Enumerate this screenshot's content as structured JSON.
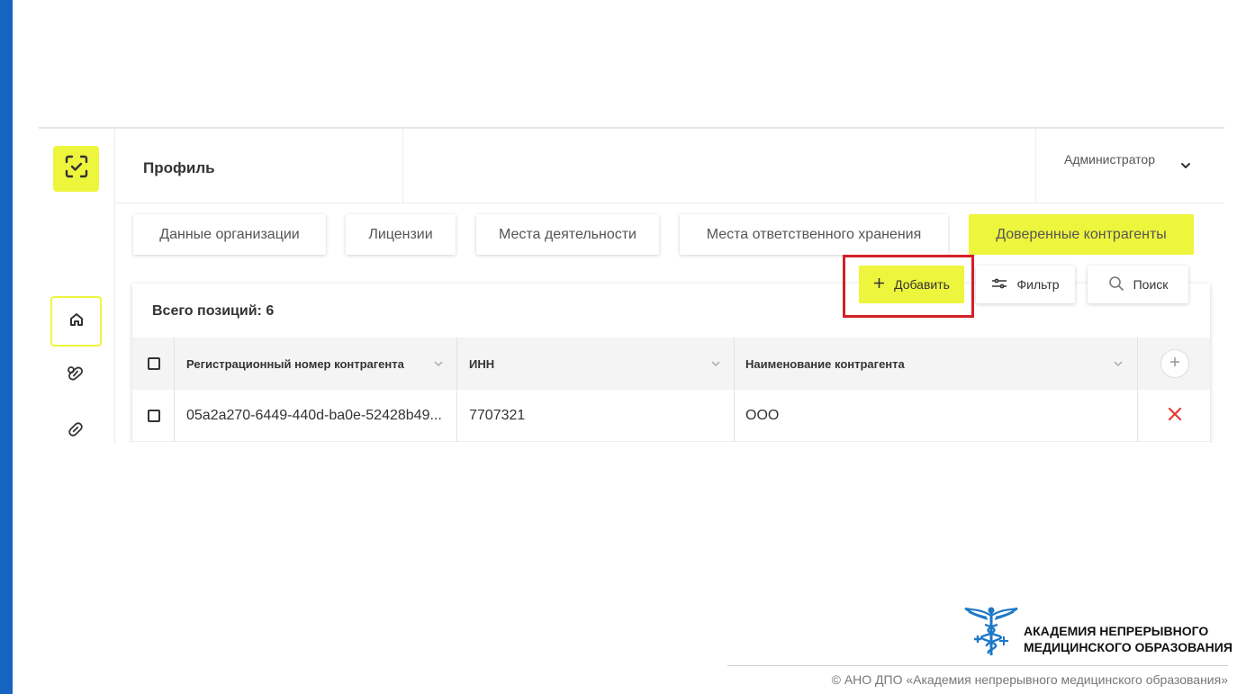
{
  "colors": {
    "accent": "#eef53d",
    "highlight": "#d32027",
    "brand_blue": "#1565c0",
    "delete": "#e53935"
  },
  "header": {
    "title": "Профиль",
    "user": "Администратор"
  },
  "sidebar": {
    "icons": [
      "scan-check-icon",
      "home-icon",
      "pills-icon",
      "capsule-icon"
    ]
  },
  "tabs": [
    {
      "label": "Данные организации",
      "active": false
    },
    {
      "label": "Лицензии",
      "active": false
    },
    {
      "label": "Места деятельности",
      "active": false
    },
    {
      "label": "Места ответственного хранения",
      "active": false
    },
    {
      "label": "Доверенные контрагенты",
      "active": true
    }
  ],
  "toolbar": {
    "add": "Добавить",
    "filter": "Фильтр",
    "search": "Поиск"
  },
  "table": {
    "total": "Всего позиций: 6",
    "columns": [
      "Регистрационный номер контрагента",
      "ИНН",
      "Наименование контрагента"
    ],
    "rows": [
      {
        "reg": "05a2a270-6449-440d-ba0e-52428b49...",
        "inn": "7707321",
        "name": "ООО"
      }
    ]
  },
  "footer": {
    "brand_line1": "АКАДЕМИЯ НЕПРЕРЫВНОГО",
    "brand_line2": "МЕДИЦИНСКОГО ОБРАЗОВАНИЯ",
    "copyright": "© АНО ДПО «Академия непрерывного медицинского образования»"
  }
}
